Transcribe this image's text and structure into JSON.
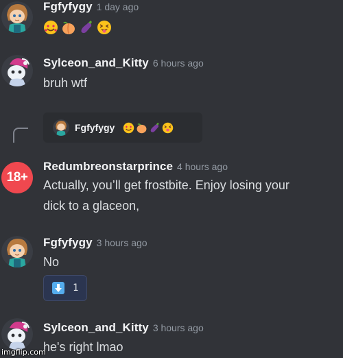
{
  "messages": [
    {
      "username": "Fgfyfygy",
      "timestamp": "1 day ago",
      "emojis": [
        "smiling-face-hearts",
        "peach",
        "eggplant",
        "squinting-tongue-face"
      ]
    },
    {
      "username": "Sylceon_and_Kitty",
      "timestamp": "6 hours ago",
      "text": "bruh wtf"
    },
    {
      "reply_to": {
        "username": "Fgfyfygy",
        "emojis": [
          "smiling-face-hearts",
          "peach",
          "eggplant",
          "squinting-tongue-face"
        ]
      },
      "avatar_badge": "18+",
      "username": "Redumbreonstarprince",
      "timestamp": "4 hours ago",
      "text_line1": "Actually, you’ll get frostbite. Enjoy losing your",
      "text_line2": "dick to a glaceon,"
    },
    {
      "username": "Fgfyfygy",
      "timestamp": "3 hours ago",
      "text": "No",
      "reaction": {
        "icon": "down-arrow-emoji",
        "count": "1"
      }
    },
    {
      "username": "Sylceon_and_Kitty",
      "timestamp": "3 hours ago",
      "text": "he's right lmao"
    }
  ],
  "watermark": "imgflip.com",
  "colors": {
    "background": "#313338",
    "reply_background": "#2b2d31",
    "badge_red": "#f0484f",
    "reaction_background": "#2b3550",
    "timestamp": "#949ba4"
  }
}
